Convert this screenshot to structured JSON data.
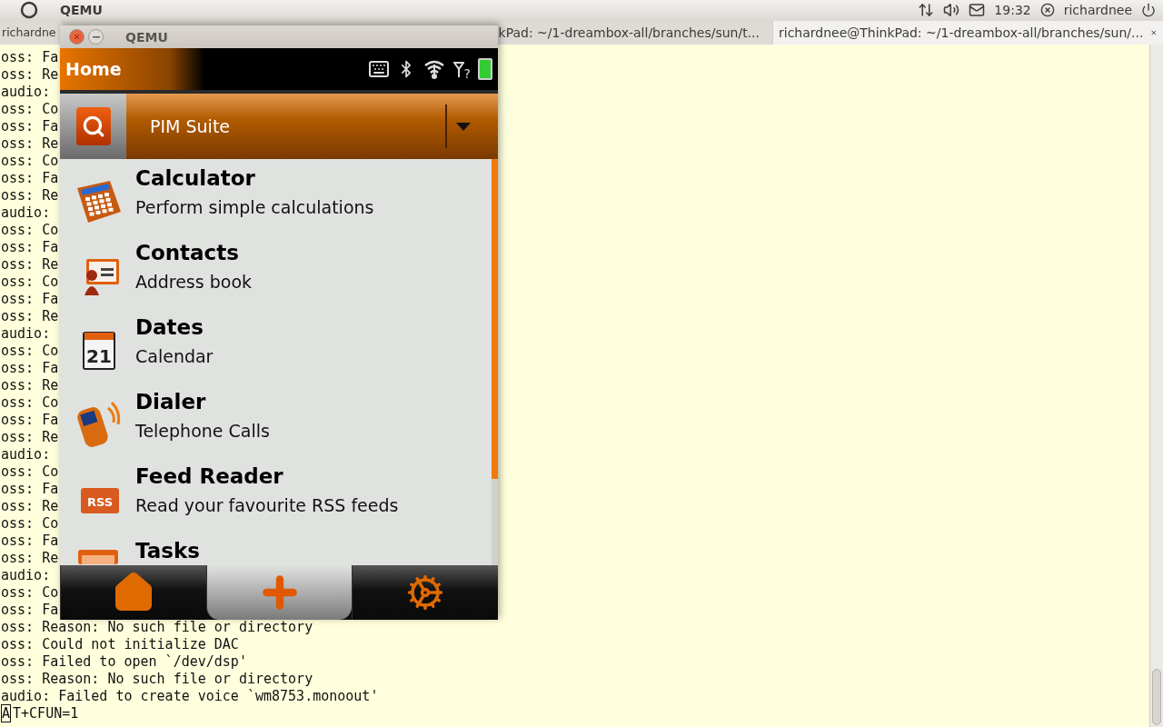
{
  "panel": {
    "app_title": "QEMU",
    "clock": "19:32",
    "user": "richardnee"
  },
  "terminal_tabs": [
    {
      "title": "richardne",
      "selected": false
    },
    {
      "title": "kPad: ~/1-dreambox-all/branches/sun/t...",
      "selected": false
    },
    {
      "title": "richardnee@ThinkPad: ~/1-dreambox-all/branches/sun/...",
      "selected": true
    }
  ],
  "terminal_lines": [
    "oss: Fa",
    "oss: Re",
    "audio:",
    "oss: Co",
    "oss: Fa",
    "oss: Re",
    "oss: Co",
    "oss: Fa",
    "oss: Re",
    "audio:",
    "oss: Co",
    "oss: Fa",
    "oss: Re",
    "oss: Co",
    "oss: Fa",
    "oss: Re",
    "audio:",
    "oss: Co",
    "oss: Fa",
    "oss: Re",
    "oss: Co",
    "oss: Fa",
    "oss: Re",
    "audio:",
    "oss: Co",
    "oss: Fa",
    "oss: Re",
    "oss: Co",
    "oss: Fa",
    "oss: Re",
    "audio:",
    "oss: Co",
    "oss: Fa",
    "oss: Reason: No such file or directory",
    "oss: Could not initialize DAC",
    "oss: Failed to open `/dev/dsp'",
    "oss: Reason: No such file or directory",
    "audio: Failed to create voice `wm8753.monoout'"
  ],
  "prompt": {
    "cursor_char": "A",
    "rest": "T+CFUN=1"
  },
  "emulator": {
    "window_title": "QEMU",
    "screen_title": "Home",
    "signal_mark": "?",
    "category": "PIM Suite",
    "apps": [
      {
        "kind": "calculator",
        "name": "Calculator",
        "description": "Perform simple calculations"
      },
      {
        "kind": "contacts",
        "name": "Contacts",
        "description": "Address book"
      },
      {
        "kind": "calendar",
        "name": "Dates",
        "description": "Calendar",
        "icon_text": "21"
      },
      {
        "kind": "phone",
        "name": "Dialer",
        "description": "Telephone Calls"
      },
      {
        "kind": "rss",
        "name": "Feed Reader",
        "description": "Read your favourite RSS feeds",
        "icon_text": "RSS"
      },
      {
        "kind": "tasks",
        "name": "Tasks"
      }
    ],
    "nav": [
      {
        "kind": "home",
        "selected": false
      },
      {
        "kind": "add",
        "selected": true
      },
      {
        "kind": "settings",
        "selected": false
      }
    ]
  }
}
